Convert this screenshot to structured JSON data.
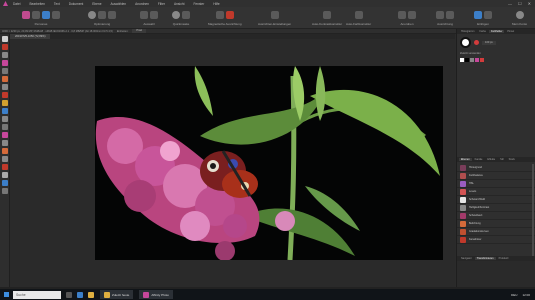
{
  "menubar": {
    "items": [
      "Datei",
      "Bearbeiten",
      "Text",
      "Dokument",
      "Ebene",
      "Auswählen",
      "Anordnen",
      "Filter",
      "Ansicht",
      "Fenster",
      "Hilfe"
    ],
    "window_controls": [
      "—",
      "☐",
      "✕"
    ]
  },
  "toolbar": {
    "groups": [
      {
        "label": "Personas"
      },
      {
        "label": "Optimierung"
      },
      {
        "label": "Auswahl"
      },
      {
        "label": "Quickmaske"
      },
      {
        "label": "Magnetische Ausrichtung"
      },
      {
        "label": "Ausrichten-Einstellungen"
      },
      {
        "label": "Auto-Kontrastkorrektur"
      },
      {
        "label": "Auto-Farbkorrektur"
      },
      {
        "label": "Anordnen"
      },
      {
        "label": "Ausrichtung"
      },
      {
        "label": "Einfügen"
      },
      {
        "label": "Mein Konto"
      }
    ]
  },
  "contextbar": {
    "info": "4000 × 2230 px, 20,09 MP, RGBA/8 · sRGB IEC61966-2.1 · 0,8 MB/MP (Alt 18.000mm F3.5 4,5)",
    "unit_label": "Einheiten:",
    "unit_value": "Pixel"
  },
  "document": {
    "tab_title": "20190725-1050 (72,89%)"
  },
  "right_panel": {
    "top_tabs": [
      "Histogramm",
      "Farbe",
      "Farbfelder",
      "Pinsel"
    ],
    "brush_size": "100 px",
    "color_label": "Zuletzt verwendet",
    "layers_tabs": [
      "Ebenen",
      "Kanäle",
      "Effekte",
      "Stil",
      "Stock"
    ],
    "layers": [
      {
        "name": "Hintergrund",
        "color": "#7a3d5a"
      },
      {
        "name": "Farbbalance",
        "color": "#b04e4e"
      },
      {
        "name": "HSL",
        "color": "#9a5cbf"
      },
      {
        "name": "Levels",
        "color": "#d35454"
      },
      {
        "name": "Schwarz/Weiß",
        "color": "#e6e6e6"
      },
      {
        "name": "Helligkeit/Kontrast",
        "color": "#888888"
      },
      {
        "name": "Schwellwert",
        "color": "#a33a6a"
      },
      {
        "name": "Belichtung",
        "color": "#d46a3a"
      },
      {
        "name": "Gradationskurven",
        "color": "#c05030"
      },
      {
        "name": "Kanalmixer",
        "color": "#c0392b"
      }
    ],
    "bottom_tabs": [
      "Navigator",
      "Transformieren",
      "Protokoll"
    ]
  },
  "taskbar": {
    "search_placeholder": "Suche",
    "apps": [
      "Zuletzt heute",
      "Affinity Photo"
    ],
    "tray": [
      "DEU",
      "12:00"
    ]
  },
  "colors": {
    "accent": "#c6479b",
    "background": "#2b2b2b"
  }
}
